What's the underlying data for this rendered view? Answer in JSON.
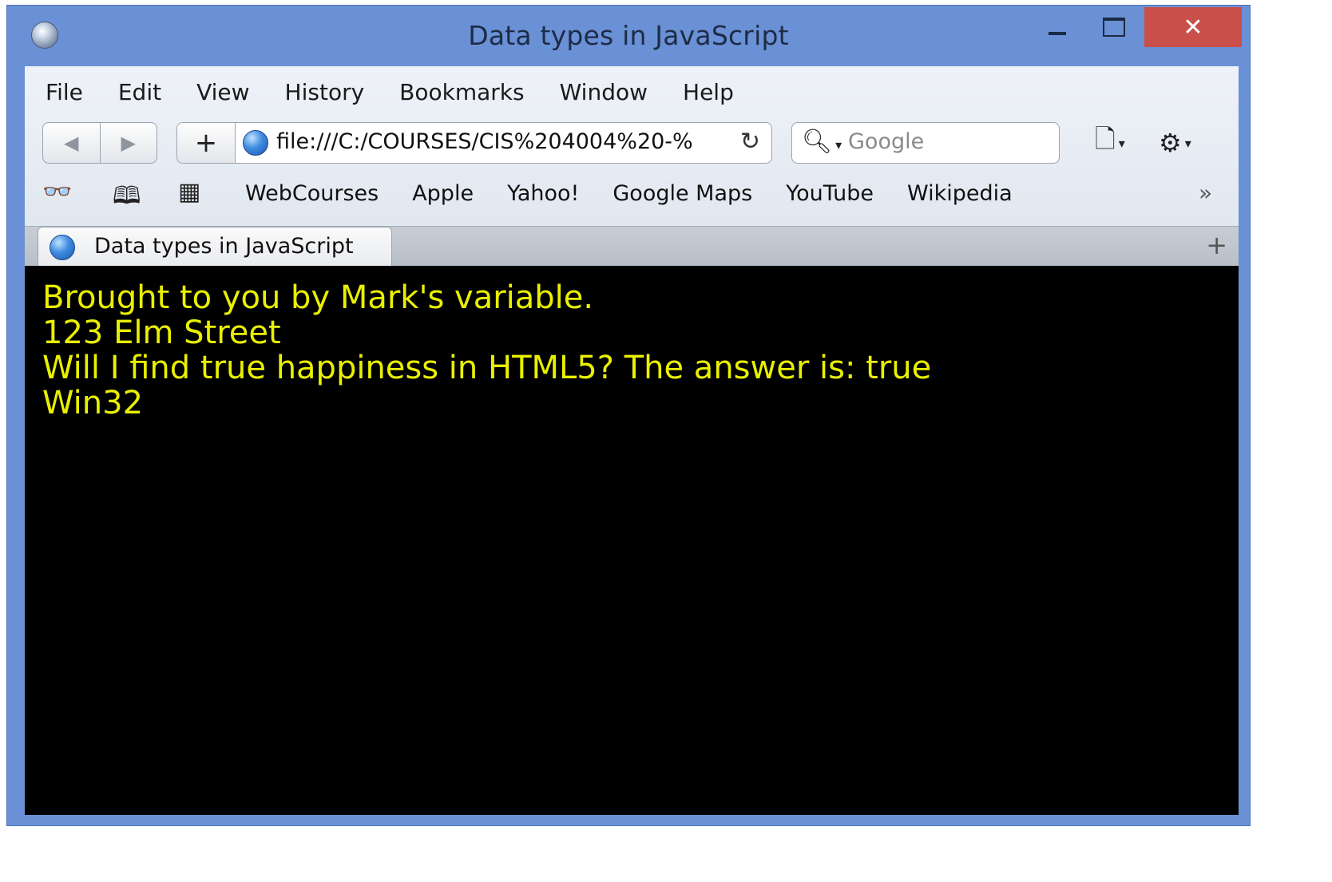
{
  "window": {
    "title": "Data types in JavaScript",
    "minimize_label": "",
    "maximize_label": "",
    "close_label": "✕"
  },
  "menu": {
    "items": [
      "File",
      "Edit",
      "View",
      "History",
      "Bookmarks",
      "Window",
      "Help"
    ]
  },
  "toolbar": {
    "back_label": "◀",
    "forward_label": "▶",
    "add_label": "+",
    "url": "file:///C:/COURSES/CIS%204004%20-%",
    "reload_label": "↻",
    "search_placeholder": "Google",
    "page_menu_label": "🗋",
    "settings_label": "⚙"
  },
  "bookmarks": {
    "reading_list_label": "👓",
    "book_label": "🕮",
    "grid_label": "▦",
    "links": [
      "WebCourses",
      "Apple",
      "Yahoo!",
      "Google Maps",
      "YouTube",
      "Wikipedia"
    ],
    "more_label": "»"
  },
  "tabs": [
    {
      "title": "Data types in JavaScript",
      "active": true
    }
  ],
  "new_tab_label": "+",
  "content": {
    "lines": [
      "Brought to you by Mark's variable.",
      "123 Elm Street",
      "Will I find true happiness in HTML5? The answer is: true",
      "Win32"
    ],
    "text_color": "#e9f000",
    "background_color": "#000000"
  },
  "icons": [
    "browser-app-icon",
    "globe-icon",
    "search-icon",
    "page-menu-icon",
    "gear-icon",
    "reading-list-icon",
    "book-icon",
    "grid-icon"
  ]
}
